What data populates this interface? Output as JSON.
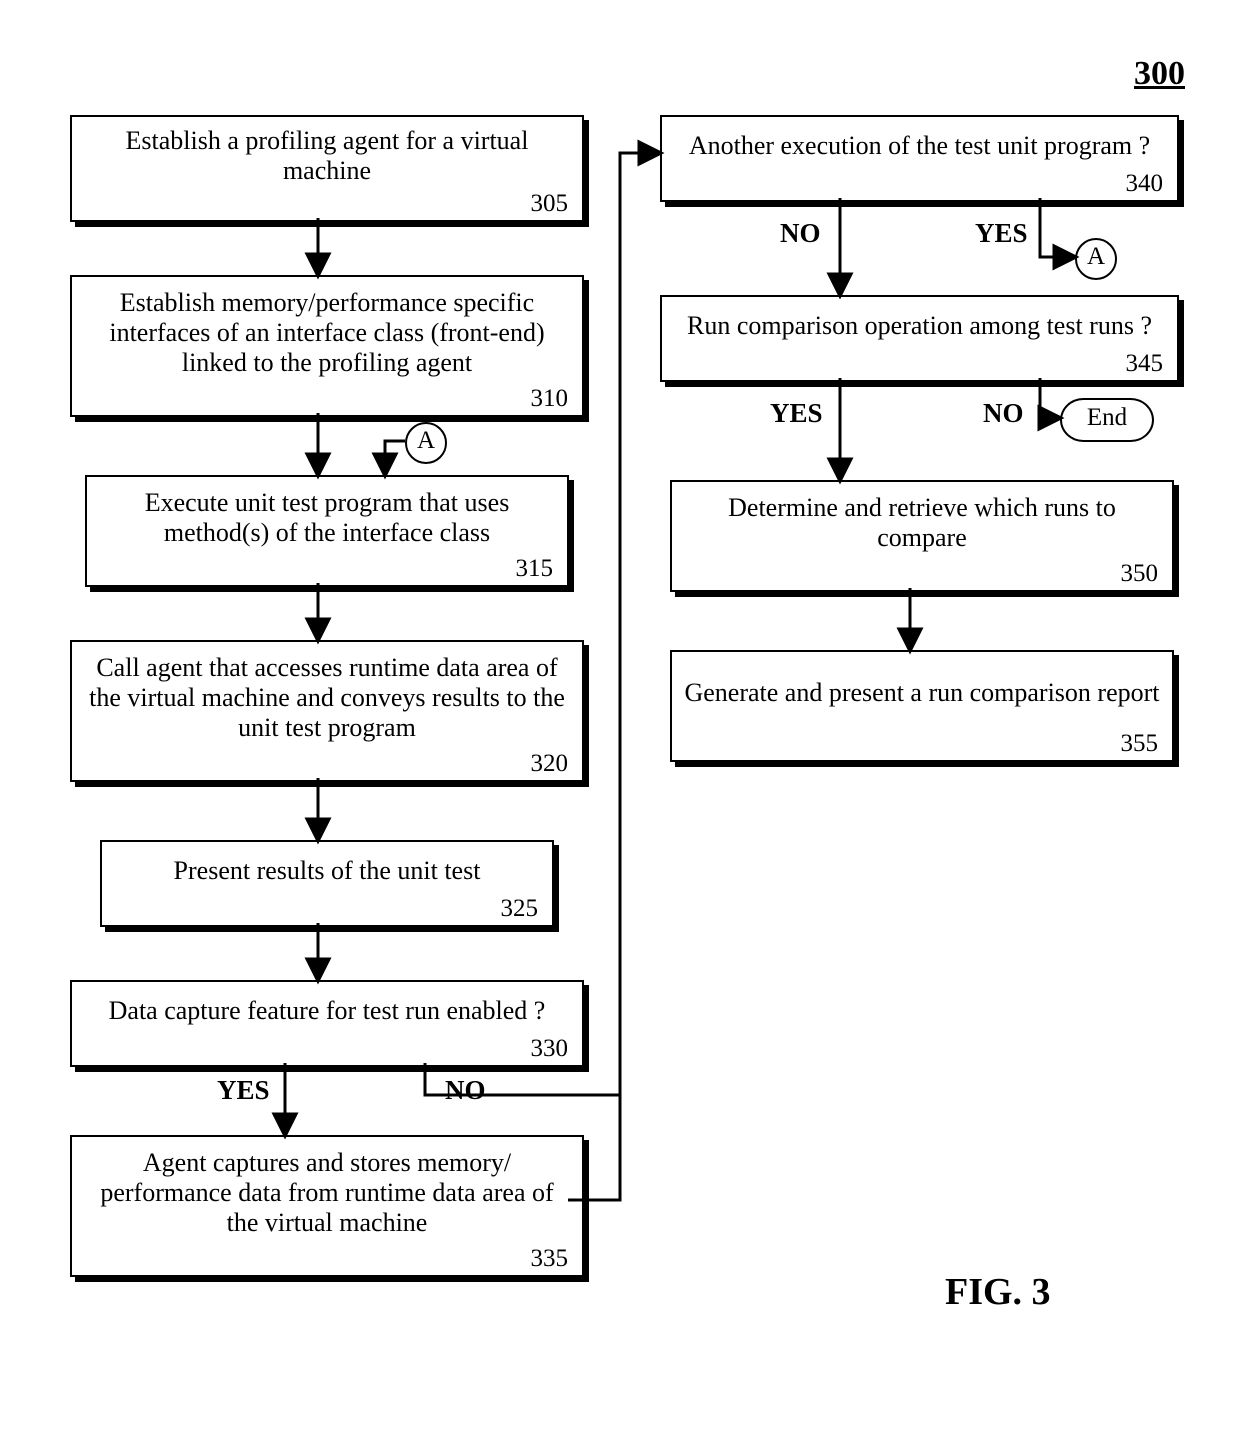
{
  "figure_number": "300",
  "figure_caption": "FIG. 3",
  "connector_label": "A",
  "end_label": "End",
  "labels": {
    "yes": "YES",
    "no": "NO"
  },
  "left": {
    "b305": {
      "text": "Establish a profiling agent for a virtual machine",
      "num": "305"
    },
    "b310": {
      "text": "Establish memory/performance specific interfaces of an interface class (front-end) linked to the profiling agent",
      "num": "310"
    },
    "b315": {
      "text": "Execute unit test program that uses method(s) of the interface class",
      "num": "315"
    },
    "b320": {
      "text": "Call agent that accesses runtime data area of the virtual machine and conveys results to the unit test program",
      "num": "320"
    },
    "b325": {
      "text": "Present results of the unit test",
      "num": "325"
    },
    "b330": {
      "text": "Data capture feature for test run enabled ?",
      "num": "330"
    },
    "b335": {
      "text": "Agent captures and stores memory/ performance data from runtime data area of the virtual machine",
      "num": "335"
    }
  },
  "right": {
    "b340": {
      "text": "Another execution of the test unit program ?",
      "num": "340"
    },
    "b345": {
      "text": "Run comparison operation among test runs ?",
      "num": "345"
    },
    "b350": {
      "text": "Determine and retrieve which runs to compare",
      "num": "350"
    },
    "b355": {
      "text": "Generate and present a run comparison report",
      "num": "355"
    }
  },
  "chart_data": {
    "type": "flowchart",
    "nodes": [
      {
        "id": "305",
        "label": "Establish a profiling agent for a virtual machine",
        "kind": "process"
      },
      {
        "id": "310",
        "label": "Establish memory/performance specific interfaces of an interface class (front-end) linked to the profiling agent",
        "kind": "process"
      },
      {
        "id": "315",
        "label": "Execute unit test program that uses method(s) of the interface class",
        "kind": "process"
      },
      {
        "id": "320",
        "label": "Call agent that accesses runtime data area of the virtual machine and conveys results to the unit test program",
        "kind": "process"
      },
      {
        "id": "325",
        "label": "Present results of the unit test",
        "kind": "process"
      },
      {
        "id": "330",
        "label": "Data capture feature for test run enabled ?",
        "kind": "decision"
      },
      {
        "id": "335",
        "label": "Agent captures and stores memory/ performance data from runtime data area of the virtual machine",
        "kind": "process"
      },
      {
        "id": "340",
        "label": "Another execution of the test unit program ?",
        "kind": "decision"
      },
      {
        "id": "345",
        "label": "Run comparison operation among test runs ?",
        "kind": "decision"
      },
      {
        "id": "350",
        "label": "Determine and retrieve which runs to compare",
        "kind": "process"
      },
      {
        "id": "355",
        "label": "Generate and present a run comparison report",
        "kind": "process"
      },
      {
        "id": "A",
        "label": "A",
        "kind": "connector"
      },
      {
        "id": "End",
        "label": "End",
        "kind": "terminator"
      }
    ],
    "edges": [
      {
        "from": "305",
        "to": "310"
      },
      {
        "from": "310",
        "to": "315"
      },
      {
        "from": "A",
        "to": "315"
      },
      {
        "from": "315",
        "to": "320"
      },
      {
        "from": "320",
        "to": "325"
      },
      {
        "from": "325",
        "to": "330"
      },
      {
        "from": "330",
        "to": "335",
        "label": "YES"
      },
      {
        "from": "330",
        "to": "340",
        "label": "NO"
      },
      {
        "from": "335",
        "to": "340"
      },
      {
        "from": "340",
        "to": "A",
        "label": "YES"
      },
      {
        "from": "340",
        "to": "345",
        "label": "NO"
      },
      {
        "from": "345",
        "to": "350",
        "label": "YES"
      },
      {
        "from": "345",
        "to": "End",
        "label": "NO"
      },
      {
        "from": "350",
        "to": "355"
      }
    ]
  }
}
